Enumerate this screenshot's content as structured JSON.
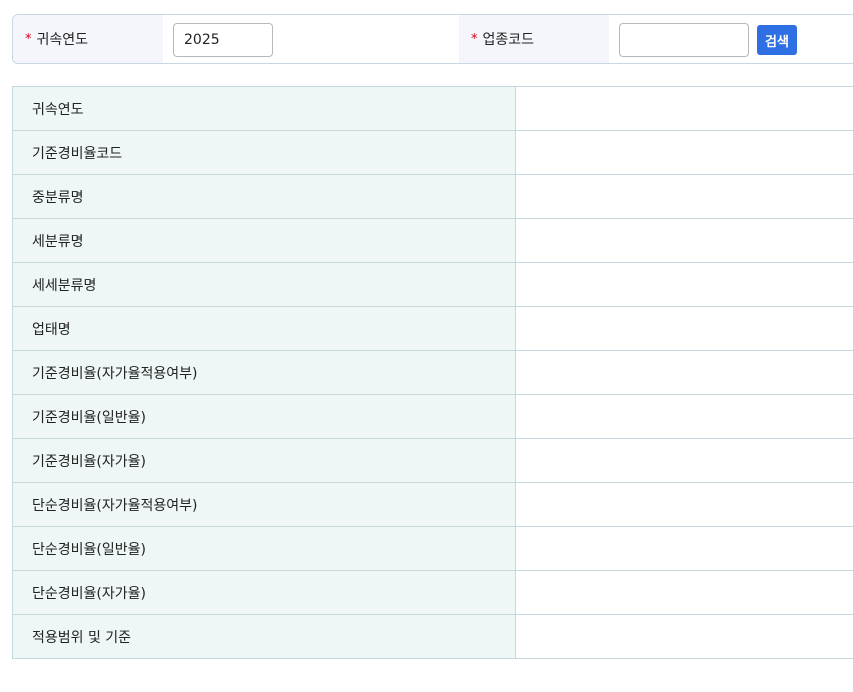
{
  "search": {
    "year_label": "귀속연도",
    "year_value": "2025",
    "code_label": "업종코드",
    "code_value": "",
    "required_mark": "*",
    "search_button_label": "검색"
  },
  "detail": {
    "rows": [
      {
        "label": "귀속연도",
        "value": ""
      },
      {
        "label": "기준경비율코드",
        "value": ""
      },
      {
        "label": "중분류명",
        "value": ""
      },
      {
        "label": "세분류명",
        "value": ""
      },
      {
        "label": "세세분류명",
        "value": ""
      },
      {
        "label": "업태명",
        "value": ""
      },
      {
        "label": "기준경비율(자가율적용여부)",
        "value": ""
      },
      {
        "label": "기준경비율(일반율)",
        "value": ""
      },
      {
        "label": "기준경비율(자가율)",
        "value": ""
      },
      {
        "label": "단순경비율(자가율적용여부)",
        "value": ""
      },
      {
        "label": "단순경비율(일반율)",
        "value": ""
      },
      {
        "label": "단순경비율(자가율)",
        "value": ""
      },
      {
        "label": "적용범위 및 기준",
        "value": ""
      }
    ]
  }
}
